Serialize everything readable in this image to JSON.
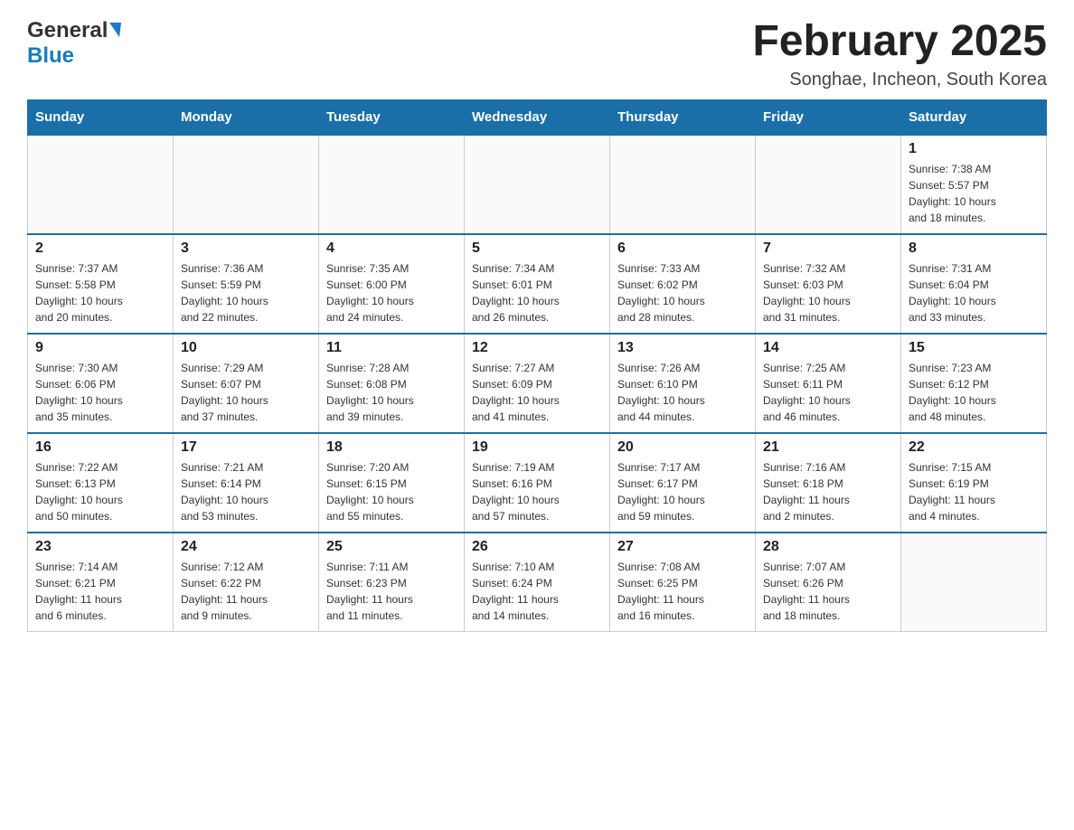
{
  "header": {
    "logo": {
      "general_text": "General",
      "blue_text": "Blue"
    },
    "title": "February 2025",
    "location": "Songhae, Incheon, South Korea"
  },
  "calendar": {
    "days_of_week": [
      "Sunday",
      "Monday",
      "Tuesday",
      "Wednesday",
      "Thursday",
      "Friday",
      "Saturday"
    ],
    "weeks": [
      {
        "days": [
          {
            "number": "",
            "info": ""
          },
          {
            "number": "",
            "info": ""
          },
          {
            "number": "",
            "info": ""
          },
          {
            "number": "",
            "info": ""
          },
          {
            "number": "",
            "info": ""
          },
          {
            "number": "",
            "info": ""
          },
          {
            "number": "1",
            "info": "Sunrise: 7:38 AM\nSunset: 5:57 PM\nDaylight: 10 hours\nand 18 minutes."
          }
        ]
      },
      {
        "days": [
          {
            "number": "2",
            "info": "Sunrise: 7:37 AM\nSunset: 5:58 PM\nDaylight: 10 hours\nand 20 minutes."
          },
          {
            "number": "3",
            "info": "Sunrise: 7:36 AM\nSunset: 5:59 PM\nDaylight: 10 hours\nand 22 minutes."
          },
          {
            "number": "4",
            "info": "Sunrise: 7:35 AM\nSunset: 6:00 PM\nDaylight: 10 hours\nand 24 minutes."
          },
          {
            "number": "5",
            "info": "Sunrise: 7:34 AM\nSunset: 6:01 PM\nDaylight: 10 hours\nand 26 minutes."
          },
          {
            "number": "6",
            "info": "Sunrise: 7:33 AM\nSunset: 6:02 PM\nDaylight: 10 hours\nand 28 minutes."
          },
          {
            "number": "7",
            "info": "Sunrise: 7:32 AM\nSunset: 6:03 PM\nDaylight: 10 hours\nand 31 minutes."
          },
          {
            "number": "8",
            "info": "Sunrise: 7:31 AM\nSunset: 6:04 PM\nDaylight: 10 hours\nand 33 minutes."
          }
        ]
      },
      {
        "days": [
          {
            "number": "9",
            "info": "Sunrise: 7:30 AM\nSunset: 6:06 PM\nDaylight: 10 hours\nand 35 minutes."
          },
          {
            "number": "10",
            "info": "Sunrise: 7:29 AM\nSunset: 6:07 PM\nDaylight: 10 hours\nand 37 minutes."
          },
          {
            "number": "11",
            "info": "Sunrise: 7:28 AM\nSunset: 6:08 PM\nDaylight: 10 hours\nand 39 minutes."
          },
          {
            "number": "12",
            "info": "Sunrise: 7:27 AM\nSunset: 6:09 PM\nDaylight: 10 hours\nand 41 minutes."
          },
          {
            "number": "13",
            "info": "Sunrise: 7:26 AM\nSunset: 6:10 PM\nDaylight: 10 hours\nand 44 minutes."
          },
          {
            "number": "14",
            "info": "Sunrise: 7:25 AM\nSunset: 6:11 PM\nDaylight: 10 hours\nand 46 minutes."
          },
          {
            "number": "15",
            "info": "Sunrise: 7:23 AM\nSunset: 6:12 PM\nDaylight: 10 hours\nand 48 minutes."
          }
        ]
      },
      {
        "days": [
          {
            "number": "16",
            "info": "Sunrise: 7:22 AM\nSunset: 6:13 PM\nDaylight: 10 hours\nand 50 minutes."
          },
          {
            "number": "17",
            "info": "Sunrise: 7:21 AM\nSunset: 6:14 PM\nDaylight: 10 hours\nand 53 minutes."
          },
          {
            "number": "18",
            "info": "Sunrise: 7:20 AM\nSunset: 6:15 PM\nDaylight: 10 hours\nand 55 minutes."
          },
          {
            "number": "19",
            "info": "Sunrise: 7:19 AM\nSunset: 6:16 PM\nDaylight: 10 hours\nand 57 minutes."
          },
          {
            "number": "20",
            "info": "Sunrise: 7:17 AM\nSunset: 6:17 PM\nDaylight: 10 hours\nand 59 minutes."
          },
          {
            "number": "21",
            "info": "Sunrise: 7:16 AM\nSunset: 6:18 PM\nDaylight: 11 hours\nand 2 minutes."
          },
          {
            "number": "22",
            "info": "Sunrise: 7:15 AM\nSunset: 6:19 PM\nDaylight: 11 hours\nand 4 minutes."
          }
        ]
      },
      {
        "days": [
          {
            "number": "23",
            "info": "Sunrise: 7:14 AM\nSunset: 6:21 PM\nDaylight: 11 hours\nand 6 minutes."
          },
          {
            "number": "24",
            "info": "Sunrise: 7:12 AM\nSunset: 6:22 PM\nDaylight: 11 hours\nand 9 minutes."
          },
          {
            "number": "25",
            "info": "Sunrise: 7:11 AM\nSunset: 6:23 PM\nDaylight: 11 hours\nand 11 minutes."
          },
          {
            "number": "26",
            "info": "Sunrise: 7:10 AM\nSunset: 6:24 PM\nDaylight: 11 hours\nand 14 minutes."
          },
          {
            "number": "27",
            "info": "Sunrise: 7:08 AM\nSunset: 6:25 PM\nDaylight: 11 hours\nand 16 minutes."
          },
          {
            "number": "28",
            "info": "Sunrise: 7:07 AM\nSunset: 6:26 PM\nDaylight: 11 hours\nand 18 minutes."
          },
          {
            "number": "",
            "info": ""
          }
        ]
      }
    ]
  }
}
